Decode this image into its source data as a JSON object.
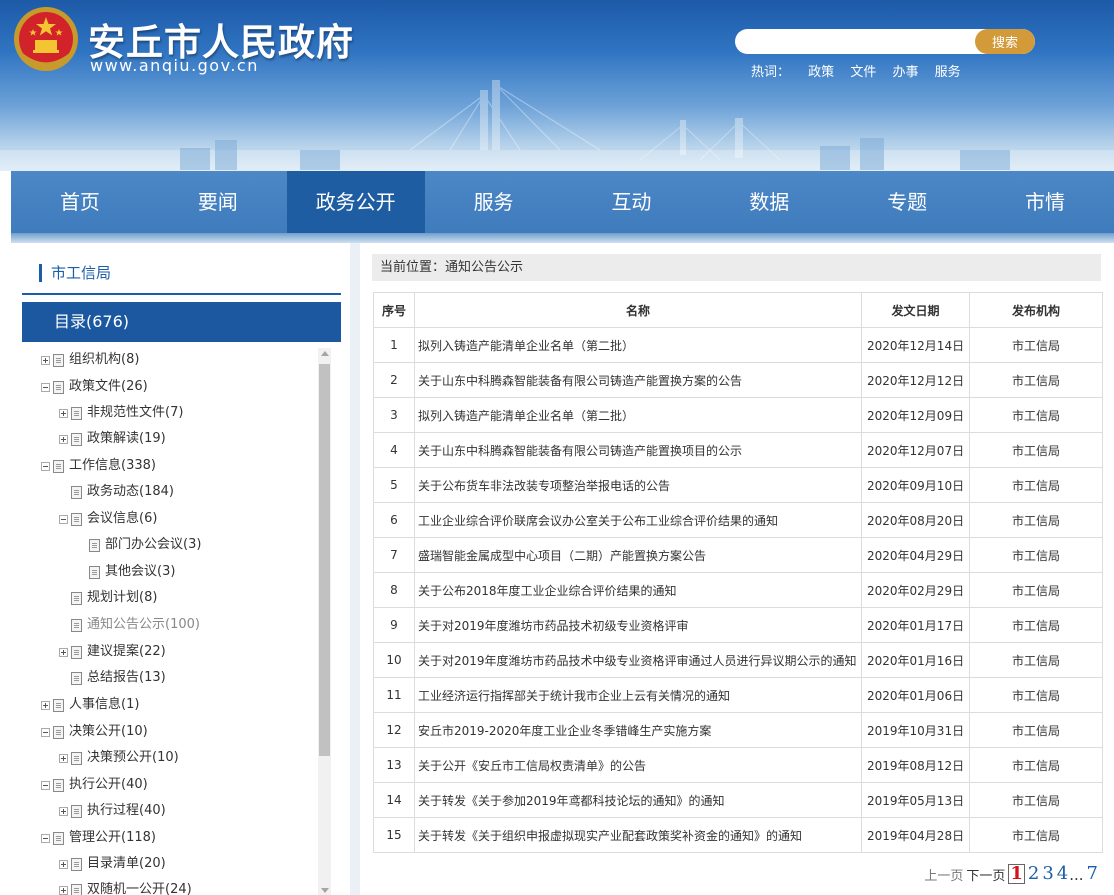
{
  "header": {
    "site_title": "安丘市人民政府",
    "site_domain": "www.anqiu.gov.cn",
    "search": {
      "placeholder": "",
      "button_label": "搜索"
    },
    "hot_words": {
      "label": "热词：",
      "items": [
        "政策",
        "文件",
        "办事",
        "服务"
      ]
    }
  },
  "nav": {
    "items": [
      "首页",
      "要闻",
      "政务公开",
      "服务",
      "互动",
      "数据",
      "专题",
      "市情"
    ],
    "active_index": 2
  },
  "sidebar": {
    "title": "市工信局",
    "catalog_label": "目录(676)",
    "tree": [
      {
        "label": "组织机构(8)",
        "level": 0,
        "expander": "plus"
      },
      {
        "label": "政策文件(26)",
        "level": 0,
        "expander": "minus"
      },
      {
        "label": "非规范性文件(7)",
        "level": 1,
        "expander": "plus"
      },
      {
        "label": "政策解读(19)",
        "level": 1,
        "expander": "plus"
      },
      {
        "label": "工作信息(338)",
        "level": 0,
        "expander": "minus"
      },
      {
        "label": "政务动态(184)",
        "level": 1,
        "expander": "none"
      },
      {
        "label": "会议信息(6)",
        "level": 1,
        "expander": "minus"
      },
      {
        "label": "部门办公会议(3)",
        "level": 2,
        "expander": "none"
      },
      {
        "label": "其他会议(3)",
        "level": 2,
        "expander": "none"
      },
      {
        "label": "规划计划(8)",
        "level": 1,
        "expander": "none"
      },
      {
        "label": "通知公告公示(100)",
        "level": 1,
        "expander": "none",
        "current": true
      },
      {
        "label": "建议提案(22)",
        "level": 1,
        "expander": "plus"
      },
      {
        "label": "总结报告(13)",
        "level": 1,
        "expander": "none"
      },
      {
        "label": "人事信息(1)",
        "level": 0,
        "expander": "plus"
      },
      {
        "label": "决策公开(10)",
        "level": 0,
        "expander": "minus"
      },
      {
        "label": "决策预公开(10)",
        "level": 1,
        "expander": "plus"
      },
      {
        "label": "执行公开(40)",
        "level": 0,
        "expander": "minus"
      },
      {
        "label": "执行过程(40)",
        "level": 1,
        "expander": "plus"
      },
      {
        "label": "管理公开(118)",
        "level": 0,
        "expander": "minus"
      },
      {
        "label": "目录清单(20)",
        "level": 1,
        "expander": "plus"
      },
      {
        "label": "双随机一公开(24)",
        "level": 1,
        "expander": "plus"
      }
    ]
  },
  "main": {
    "breadcrumb": "当前位置：通知公告公示",
    "table": {
      "headers": [
        "序号",
        "名称",
        "发文日期",
        "发布机构"
      ],
      "rows": [
        [
          "1",
          "拟列入铸造产能清单企业名单（第二批）",
          "2020年12月14日",
          "市工信局"
        ],
        [
          "2",
          "关于山东中科腾森智能装备有限公司铸造产能置换方案的公告",
          "2020年12月12日",
          "市工信局"
        ],
        [
          "3",
          "拟列入铸造产能清单企业名单（第二批）",
          "2020年12月09日",
          "市工信局"
        ],
        [
          "4",
          "关于山东中科腾森智能装备有限公司铸造产能置换项目的公示",
          "2020年12月07日",
          "市工信局"
        ],
        [
          "5",
          "关于公布货车非法改装专项整治举报电话的公告",
          "2020年09月10日",
          "市工信局"
        ],
        [
          "6",
          "工业企业综合评价联席会议办公室关于公布工业综合评价结果的通知",
          "2020年08月20日",
          "市工信局"
        ],
        [
          "7",
          "盛瑞智能金属成型中心项目（二期）产能置换方案公告",
          "2020年04月29日",
          "市工信局"
        ],
        [
          "8",
          "关于公布2018年度工业企业综合评价结果的通知",
          "2020年02月29日",
          "市工信局"
        ],
        [
          "9",
          "关于对2019年度潍坊市药品技术初级专业资格评审",
          "2020年01月17日",
          "市工信局"
        ],
        [
          "10",
          "关于对2019年度潍坊市药品技术中级专业资格评审通过人员进行异议期公示的通知",
          "2020年01月16日",
          "市工信局"
        ],
        [
          "11",
          "工业经济运行指挥部关于统计我市企业上云有关情况的通知",
          "2020年01月06日",
          "市工信局"
        ],
        [
          "12",
          "安丘市2019-2020年度工业企业冬季错峰生产实施方案",
          "2019年10月31日",
          "市工信局"
        ],
        [
          "13",
          "关于公开《安丘市工信局权责清单》的公告",
          "2019年08月12日",
          "市工信局"
        ],
        [
          "14",
          "关于转发《关于参加2019年鸢都科技论坛的通知》的通知",
          "2019年05月13日",
          "市工信局"
        ],
        [
          "15",
          "关于转发《关于组织申报虚拟现实产业配套政策奖补资金的通知》的通知",
          "2019年04月28日",
          "市工信局"
        ]
      ]
    },
    "pager": {
      "prev_label": "上一页",
      "next_label": "下一页",
      "pages": [
        "1",
        "2",
        "3",
        "4"
      ],
      "current": "1",
      "ellipsis": "...",
      "last": "7"
    }
  },
  "colors": {
    "nav_bg": "#3f7cbd",
    "nav_active": "#1f5da3",
    "catalog_bg": "#1b58a0",
    "accent": "#1a5ea8",
    "search_button": "#d39a3a",
    "pager_current": "#d1141b"
  },
  "icons": [
    "national-emblem-icon",
    "tree-plus-icon",
    "tree-minus-icon",
    "document-icon",
    "scroll-up-arrow-icon",
    "scroll-down-arrow-icon"
  ]
}
